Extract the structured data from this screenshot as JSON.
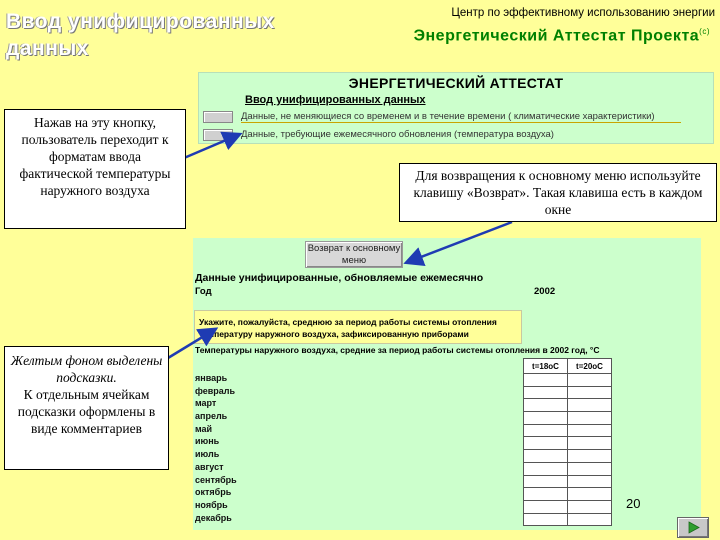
{
  "header": {
    "slide_title": "Ввод унифицированных данных",
    "center_name": "Центр по эффективному использованию энергии",
    "project_name": "Энергетический Аттестат Проекта",
    "project_mark": "(с)"
  },
  "attestat_window": {
    "title": "ЭНЕРГЕТИЧЕСКИЙ АТТЕСТАТ",
    "subtitle": "Ввод унифицированных данных",
    "menu_items": [
      {
        "label": "Данные, не меняющиеся со временем и в течение времени ( климатические характеристики)"
      },
      {
        "label": "Данные, требующие ежемесячного обновления (температура воздуха)"
      }
    ]
  },
  "sheet": {
    "back_button_label": "Возврат к основному меню",
    "title": "Данные унифицированные, обновляемые ежемесячно",
    "year_label": "Год",
    "year_value": "2002",
    "hint": "Укажите, пожалуйста, среднюю за период работы системы отопления температуру наружного воздуха, зафиксированную приборами",
    "temps_title": "Температуры наружного воздуха, средние за период работы системы отопления в 2002 год, °С",
    "col_1": "t=18оС",
    "col_2": "t=20оС",
    "months": [
      "январь",
      "февраль",
      "март",
      "апрель",
      "май",
      "июнь",
      "июль",
      "август",
      "сентябрь",
      "октябрь",
      "ноябрь",
      "декабрь"
    ]
  },
  "callouts": {
    "formats": "Нажав на эту кнопку, пользователь переходит к форматам ввода фактической температуры наружного воздуха",
    "return": "Для возвращения к основному меню используйте клавишу «Возврат». Такая клавиша есть в каждом окне",
    "hints_1": "Желтым фоном выделены подсказки.",
    "hints_2": "К отдельным ячейкам подсказки оформлены в виде комментариев"
  },
  "slide_number": "20",
  "icons": {
    "next": "next-arrow-icon"
  },
  "colors": {
    "background": "#ffff99",
    "panel": "#ccffcc",
    "accent": "#008000",
    "arrow": "#1f3bb3"
  }
}
